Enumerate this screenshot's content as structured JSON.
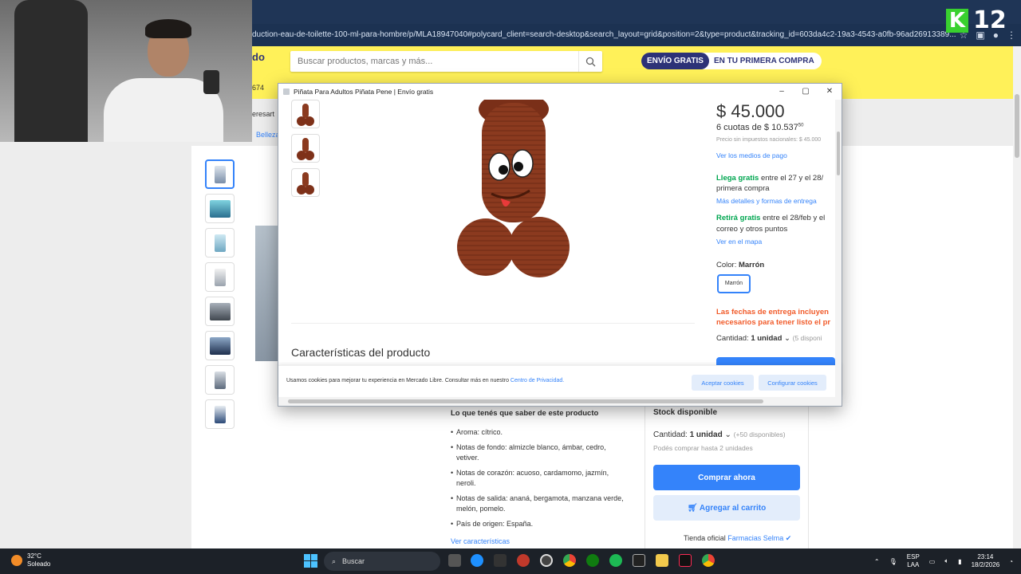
{
  "browser": {
    "url": "duction-eau-de-toilette-100-ml-para-hombre/p/MLA18947040#polycard_client=search-desktop&search_layout=grid&position=2&type=product&tracking_id=603da4c2-19a3-4543-a0fb-96ad26913389..."
  },
  "header": {
    "logo_fragment": "do",
    "search_placeholder": "Buscar productos, marcas y más...",
    "promo_strong": "ENVÍO GRATIS",
    "promo_rest": "EN TU PRIMERA COMPRA",
    "left_number": "674"
  },
  "page": {
    "left_fragment": "eresart",
    "category_fragment": "Belleza",
    "lo_que_tenes": "Lo que tenés que saber de este producto",
    "features": [
      "Aroma: cítrico.",
      "Notas de fondo: almizcle blanco, ámbar, cedro, vetiver.",
      "Notas de corazón: acuoso, cardamomo, jazmín, neroli.",
      "Notas de salida: ananá, bergamota, manzana verde, melón, pomelo.",
      "País de origen: España."
    ],
    "ver_caracteristicas": "Ver características",
    "stock": "Stock disponible",
    "cantidad_label": "Cantidad:",
    "cantidad_value": "1 unidad",
    "cantidad_avail": "(+50 disponibles)",
    "podes_comprar": "Podés comprar hasta 2 unidades",
    "comprar_ahora": "Comprar ahora",
    "agregar_carrito": "Agregar al carrito",
    "tienda_label": "Tienda oficial",
    "tienda_name": "Farmacias Selma"
  },
  "popup": {
    "title": "Piñata Para Adultos Piñata Pene | Envío gratis",
    "price": "$ 45.000",
    "cuotas": "6 cuotas de $ 10.537",
    "cuotas_cents": "50",
    "sin_impuestos": "Precio sin impuestos nacionales: $ 45.000",
    "medios_pago": "Ver los medios de pago",
    "llega_green": "Llega gratis",
    "llega_rest": "entre el 27 y el 28/",
    "primera_compra": "primera compra",
    "mas_detalles": "Más detalles y formas de entrega",
    "retira_green": "Retirá gratis",
    "retira_rest": "entre el 28/feb y el",
    "correo": "correo y otros puntos",
    "ver_mapa": "Ver en el mapa",
    "color_label": "Color:",
    "color_value": "Marrón",
    "color_option": "Marrón",
    "fechas_line1": "Las fechas de entrega incluyen",
    "fechas_line2": "necesarios para tener listo el pr",
    "cantidad_label": "Cantidad:",
    "cantidad_value": "1 unidad",
    "cantidad_avail": "(5 disponi",
    "caracteristicas": "Características del producto",
    "cookie_text": "Usamos cookies para mejorar tu experiencia en Mercado Libre. Consultar más en nuestro",
    "cookie_link": "Centro de Privacidad.",
    "cookie_accept": "Aceptar cookies",
    "cookie_config": "Configurar cookies"
  },
  "overlay": {
    "badge_letter": "K",
    "badge_number": "12"
  },
  "taskbar": {
    "temp": "32°C",
    "weather": "Soleado",
    "search_label": "Buscar",
    "lang1": "ESP",
    "lang2": "LAA",
    "time": "23:14",
    "date": "18/2/2026"
  },
  "colors": {
    "ml_yellow": "#fff159",
    "ml_blue": "#3483fa",
    "ml_green": "#00a650",
    "ml_navy": "#2d3277",
    "pinata_brown": "#8b3a1f"
  }
}
